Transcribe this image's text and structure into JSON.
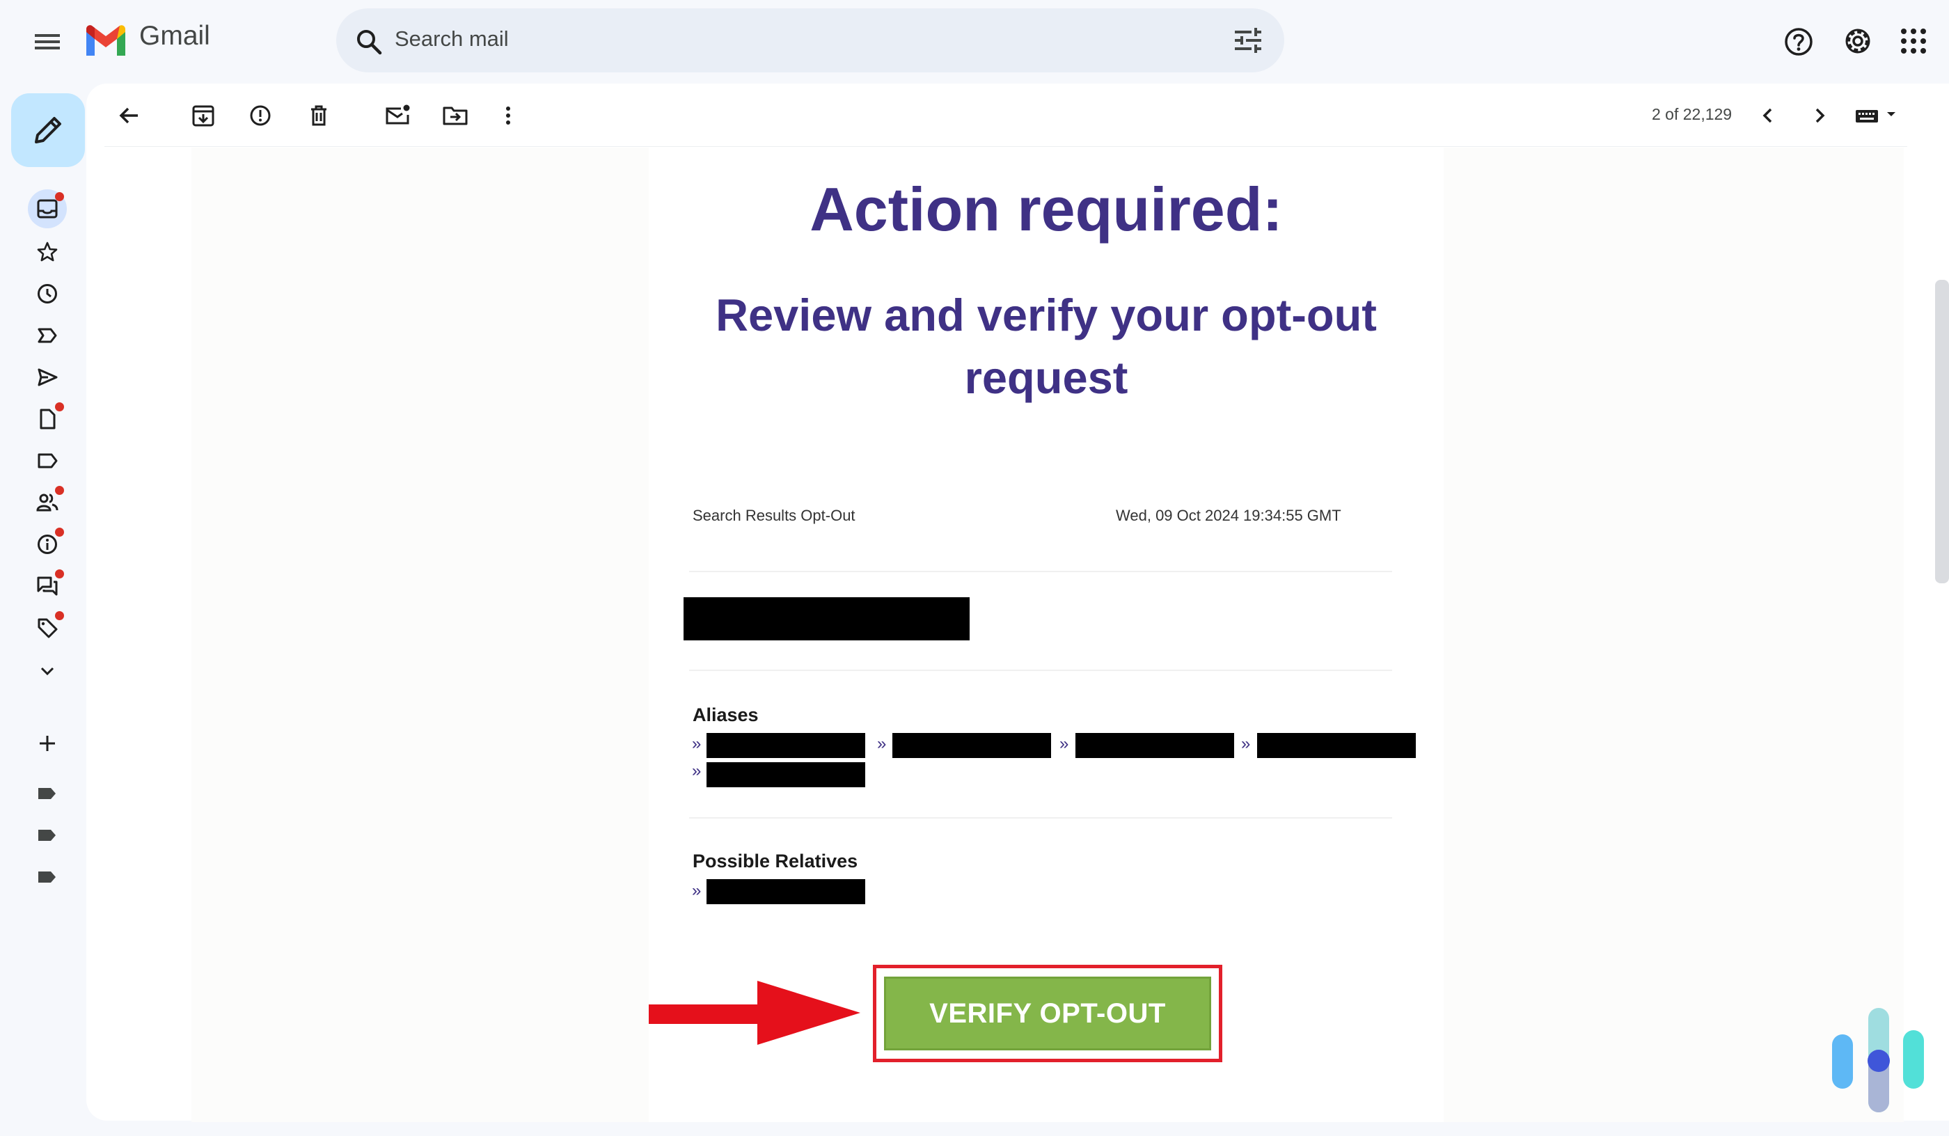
{
  "app": {
    "name": "Gmail"
  },
  "search": {
    "placeholder": "Search mail"
  },
  "pagination": {
    "text": "2 of 22,129"
  },
  "toolbar": {
    "icons": [
      "back-arrow-icon",
      "archive-icon",
      "report-spam-icon",
      "delete-icon",
      "mark-unread-icon",
      "move-to-icon",
      "more-vert-icon"
    ]
  },
  "rail": {
    "icons": [
      "inbox-icon",
      "star-icon",
      "clock-icon",
      "important-icon",
      "send-icon",
      "draft-icon",
      "label-icon",
      "people-icon",
      "info-icon",
      "forum-icon",
      "tag-icon",
      "chevron-down-icon"
    ],
    "label_colors": [
      "#444746",
      "#444746",
      "#444746"
    ]
  },
  "email": {
    "title": "Action required:",
    "subtitle": "Review and verify your opt-out request",
    "source": "Search Results Opt-Out",
    "date": "Wed, 09 Oct 2024 19:34:55 GMT",
    "aliases_title": "Aliases",
    "relatives_title": "Possible Relatives",
    "bullet": "»",
    "verify_label": "VERIFY OPT-OUT"
  },
  "colors": {
    "heading": "#3f3185",
    "verify_button": "#84b64a",
    "highlight_frame": "#e2202b",
    "arrow": "#e5101b"
  }
}
